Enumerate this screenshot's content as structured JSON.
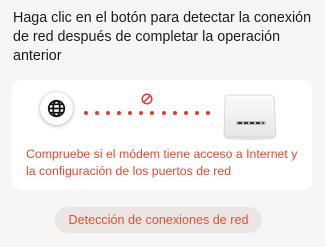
{
  "instruction_text": "Haga clic en el botón para detectar la conexión de red después de completar la operación anterior",
  "diagram": {
    "left_icon": "globe-icon",
    "status_icon": "no-connection-icon",
    "right_icon": "router-icon",
    "connection_color": "#e23b2b"
  },
  "error_message": "Compruebe si el módem tiene acceso a Internet y la configuración de los puertos de red",
  "detect_button_label": "Detección de conexiones de red",
  "colors": {
    "error": "#e04a2e",
    "button_text": "#e0522f",
    "button_bg": "#ebe6e4",
    "panel_bg": "#ffffff",
    "page_bg": "#f6f6f6"
  }
}
